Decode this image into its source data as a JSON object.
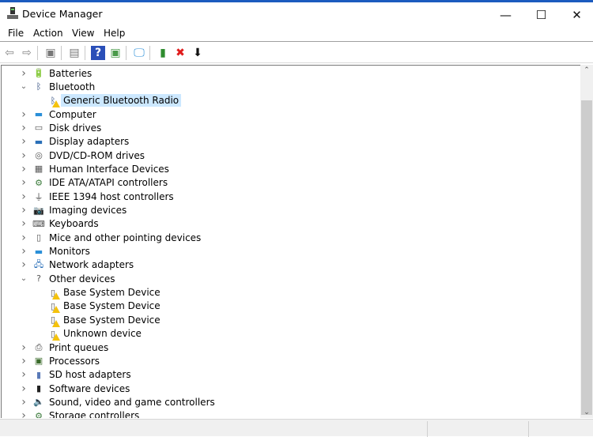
{
  "window": {
    "title": "Device Manager",
    "minimize": "—",
    "maximize": "☐",
    "close": "✕"
  },
  "menu": [
    "File",
    "Action",
    "View",
    "Help"
  ],
  "toolbar": [
    {
      "name": "back-icon",
      "glyph": "⇦",
      "color": "#888"
    },
    {
      "name": "forward-icon",
      "glyph": "⇨",
      "color": "#888"
    },
    {
      "name": "show-hide-console-tree-icon",
      "glyph": "▣",
      "color": "#777"
    },
    {
      "name": "properties-icon",
      "glyph": "▤",
      "color": "#777"
    },
    {
      "name": "help-icon",
      "glyph": "?",
      "color": "#2a4fb8"
    },
    {
      "name": "action-pane-icon",
      "glyph": "▣",
      "color": "#4a9a4a"
    },
    {
      "name": "scan-hardware-changes-icon",
      "glyph": "🖵",
      "color": "#2b8fd8"
    },
    {
      "name": "update-driver-icon",
      "glyph": "▮",
      "color": "#2f8c2f"
    },
    {
      "name": "uninstall-device-icon",
      "glyph": "✖",
      "color": "#e01b1b"
    },
    {
      "name": "disable-device-icon",
      "glyph": "⬇",
      "color": "#111"
    }
  ],
  "tree": [
    {
      "label": "Batteries",
      "level": 0,
      "state": "collapsed",
      "icon": "battery-icon",
      "glyph": "🔋",
      "color": "#3a8a3a"
    },
    {
      "label": "Bluetooth",
      "level": 0,
      "state": "expanded",
      "icon": "bluetooth-icon",
      "glyph": "ᛒ",
      "color": "#1f3e73"
    },
    {
      "label": "Generic Bluetooth Radio",
      "level": 1,
      "state": "leaf",
      "icon": "bluetooth-warning-icon",
      "glyph": "ᛒ",
      "color": "#1f3e73",
      "warning": true,
      "selected": true
    },
    {
      "label": "Computer",
      "level": 0,
      "state": "collapsed",
      "icon": "computer-icon",
      "glyph": "▬",
      "color": "#2a8fd8"
    },
    {
      "label": "Disk drives",
      "level": 0,
      "state": "collapsed",
      "icon": "disk-drive-icon",
      "glyph": "▭",
      "color": "#555"
    },
    {
      "label": "Display adapters",
      "level": 0,
      "state": "collapsed",
      "icon": "display-adapter-icon",
      "glyph": "▬",
      "color": "#2a6fb8"
    },
    {
      "label": "DVD/CD-ROM drives",
      "level": 0,
      "state": "collapsed",
      "icon": "dvd-drive-icon",
      "glyph": "◎",
      "color": "#555"
    },
    {
      "label": "Human Interface Devices",
      "level": 0,
      "state": "collapsed",
      "icon": "hid-icon",
      "glyph": "▦",
      "color": "#555"
    },
    {
      "label": "IDE ATA/ATAPI controllers",
      "level": 0,
      "state": "collapsed",
      "icon": "ide-controller-icon",
      "glyph": "⚙",
      "color": "#3a7a3a"
    },
    {
      "label": "IEEE 1394 host controllers",
      "level": 0,
      "state": "collapsed",
      "icon": "ieee1394-icon",
      "glyph": "⏚",
      "color": "#444"
    },
    {
      "label": "Imaging devices",
      "level": 0,
      "state": "collapsed",
      "icon": "camera-icon",
      "glyph": "📷",
      "color": "#555"
    },
    {
      "label": "Keyboards",
      "level": 0,
      "state": "collapsed",
      "icon": "keyboard-icon",
      "glyph": "⌨",
      "color": "#555"
    },
    {
      "label": "Mice and other pointing devices",
      "level": 0,
      "state": "collapsed",
      "icon": "mouse-icon",
      "glyph": "▯",
      "color": "#555"
    },
    {
      "label": "Monitors",
      "level": 0,
      "state": "collapsed",
      "icon": "monitor-icon",
      "glyph": "▬",
      "color": "#2a8fd8"
    },
    {
      "label": "Network adapters",
      "level": 0,
      "state": "collapsed",
      "icon": "network-adapter-icon",
      "glyph": "🖧",
      "color": "#2a6fb8"
    },
    {
      "label": "Other devices",
      "level": 0,
      "state": "expanded",
      "icon": "unknown-device-icon",
      "glyph": "?",
      "color": "#555"
    },
    {
      "label": "Base System Device",
      "level": 1,
      "state": "leaf",
      "icon": "warning-device-icon",
      "glyph": "▯",
      "color": "#555",
      "warning": true
    },
    {
      "label": "Base System Device",
      "level": 1,
      "state": "leaf",
      "icon": "warning-device-icon",
      "glyph": "▯",
      "color": "#555",
      "warning": true
    },
    {
      "label": "Base System Device",
      "level": 1,
      "state": "leaf",
      "icon": "warning-device-icon",
      "glyph": "▯",
      "color": "#555",
      "warning": true
    },
    {
      "label": "Unknown device",
      "level": 1,
      "state": "leaf",
      "icon": "warning-device-icon",
      "glyph": "▯",
      "color": "#555",
      "warning": true
    },
    {
      "label": "Print queues",
      "level": 0,
      "state": "collapsed",
      "icon": "printer-icon",
      "glyph": "⎙",
      "color": "#444"
    },
    {
      "label": "Processors",
      "level": 0,
      "state": "collapsed",
      "icon": "processor-icon",
      "glyph": "▣",
      "color": "#3a6a2a"
    },
    {
      "label": "SD host adapters",
      "level": 0,
      "state": "collapsed",
      "icon": "sd-host-icon",
      "glyph": "▮",
      "color": "#5a7ab8"
    },
    {
      "label": "Software devices",
      "level": 0,
      "state": "collapsed",
      "icon": "software-device-icon",
      "glyph": "▮",
      "color": "#222"
    },
    {
      "label": "Sound, video and game controllers",
      "level": 0,
      "state": "collapsed",
      "icon": "speaker-icon",
      "glyph": "🔈",
      "color": "#666"
    },
    {
      "label": "Storage controllers",
      "level": 0,
      "state": "collapsed",
      "icon": "storage-controller-icon",
      "glyph": "⚙",
      "color": "#3a7a3a"
    }
  ],
  "scrollbar": {
    "up": "⌃",
    "down": "⌄"
  }
}
